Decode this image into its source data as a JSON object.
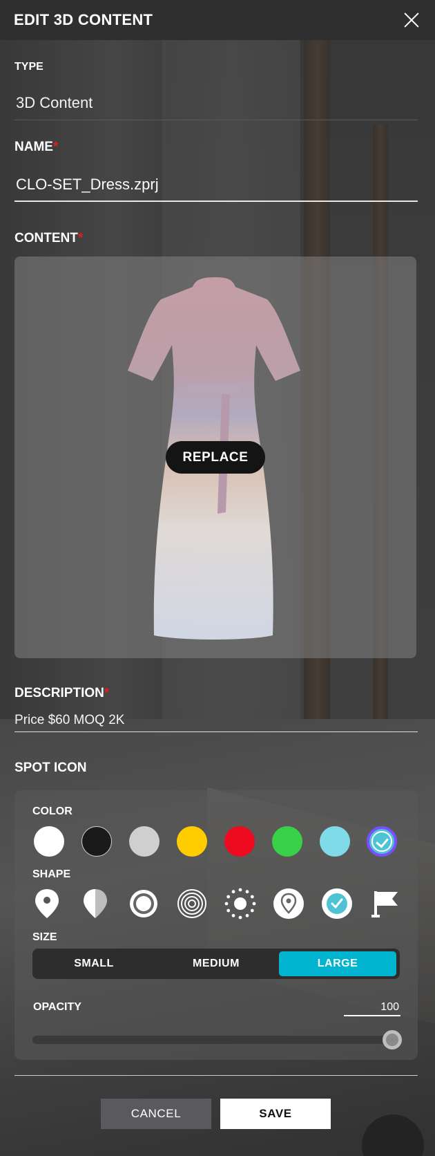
{
  "header": {
    "title": "EDIT 3D CONTENT"
  },
  "type": {
    "label": "TYPE",
    "value": "3D Content"
  },
  "name": {
    "label": "NAME",
    "required_mark": "*",
    "value": "CLO-SET_Dress.zprj"
  },
  "content": {
    "label": "CONTENT",
    "required_mark": "*",
    "replace_label": "REPLACE",
    "preview": "dress-3d-preview"
  },
  "description": {
    "label": "DESCRIPTION",
    "required_mark": "*",
    "value": "Price $60 MOQ 2K"
  },
  "spot_icon": {
    "label": "SPOT ICON",
    "color": {
      "label": "COLOR",
      "options": [
        "#ffffff",
        "#1a1a1a",
        "#cfcfcf",
        "#ffcc00",
        "#ee0a1f",
        "#39d14a",
        "#7fdbe8",
        "#4fc3d6"
      ],
      "selected_index": 7
    },
    "shape": {
      "label": "SHAPE",
      "options": [
        "pin-filled-icon",
        "pin-half-icon",
        "ring-dot-icon",
        "concentric-rings-icon",
        "dotted-ring-icon",
        "pin-outline-icon",
        "check-circle-icon",
        "flag-icon"
      ]
    },
    "size": {
      "label": "SIZE",
      "options": [
        "SMALL",
        "MEDIUM",
        "LARGE"
      ],
      "selected": "LARGE"
    },
    "opacity": {
      "label": "OPACITY",
      "value": "100",
      "fraction": 1.0
    }
  },
  "footer": {
    "cancel_label": "CANCEL",
    "save_label": "SAVE"
  },
  "colors": {
    "accent": "#00b4d0",
    "selected_ring": "#7c4dff",
    "required": "#e02020"
  }
}
